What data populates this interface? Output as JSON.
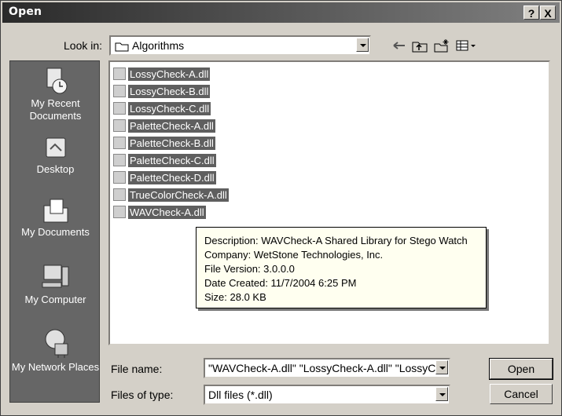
{
  "window": {
    "title": "Open",
    "help_label": "?",
    "close_label": "X"
  },
  "look_in": {
    "label": "Look in:",
    "value": "Algorithms"
  },
  "places": [
    {
      "label": "My Recent Documents",
      "icon": "recent-documents-icon"
    },
    {
      "label": "Desktop",
      "icon": "desktop-icon"
    },
    {
      "label": "My Documents",
      "icon": "my-documents-icon"
    },
    {
      "label": "My Computer",
      "icon": "my-computer-icon"
    },
    {
      "label": "My Network Places",
      "icon": "network-places-icon"
    }
  ],
  "files": [
    "LossyCheck-A.dll",
    "LossyCheck-B.dll",
    "LossyCheck-C.dll",
    "PaletteCheck-A.dll",
    "PaletteCheck-B.dll",
    "PaletteCheck-C.dll",
    "PaletteCheck-D.dll",
    "TrueColorCheck-A.dll",
    "WAVCheck-A.dll"
  ],
  "tooltip": {
    "description": "Description: WAVCheck-A Shared Library for Stego Watch",
    "company": "Company: WetStone Technologies, Inc.",
    "version": "File Version: 3.0.0.0",
    "date": "Date Created: 11/7/2004 6:25 PM",
    "size": "Size: 28.0 KB"
  },
  "file_name": {
    "label": "File name:",
    "value": "\"WAVCheck-A.dll\" \"LossyCheck-A.dll\" \"LossyC"
  },
  "file_type": {
    "label": "Files of type:",
    "value": "Dll files (*.dll)"
  },
  "buttons": {
    "open": "Open",
    "cancel": "Cancel"
  }
}
